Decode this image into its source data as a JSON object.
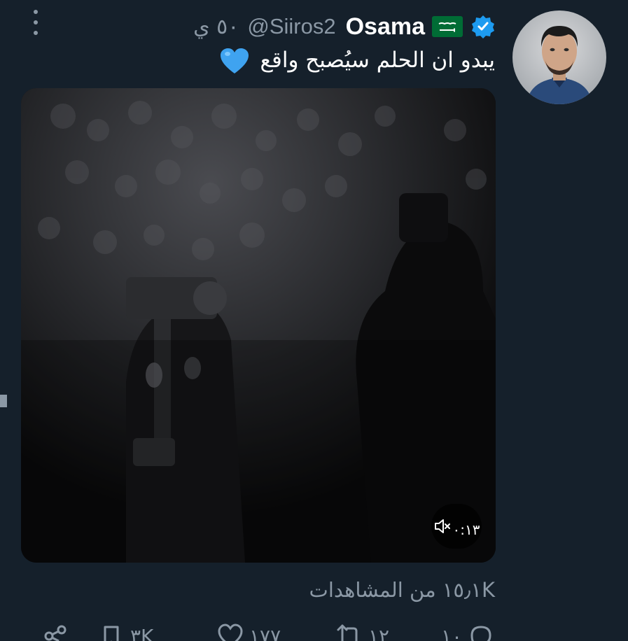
{
  "tweet": {
    "display_name": "Osama",
    "handle": "@Siiros2",
    "time": "٥٠ ي",
    "text": "يبدو ان الحلم سيُصبح واقع",
    "video_duration": "٠:١٣"
  },
  "views": {
    "count": "١٥٫١K",
    "label": "من المشاهدات"
  },
  "actions": {
    "replies": "١٠",
    "retweets": "١٢",
    "likes": "١٧٧",
    "bookmarks": "٣K"
  },
  "icons": {
    "more": "more-vertical-icon",
    "verified": "verified-badge-icon",
    "flag": "saudi-flag-icon",
    "heart": "blue-heart-emoji",
    "sound": "speaker-muted-icon"
  },
  "colors": {
    "background": "#15202b",
    "secondary_text": "#8b98a5",
    "verified": "#1d9bf0",
    "flag_green": "#006c35"
  }
}
